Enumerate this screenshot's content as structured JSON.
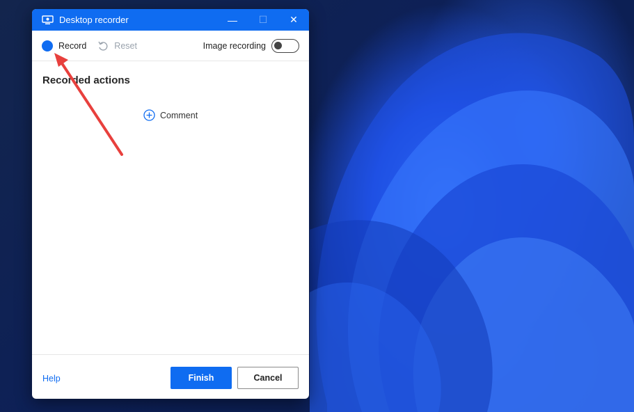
{
  "window": {
    "title": "Desktop recorder",
    "controls": {
      "minimize": "—",
      "maximize": "☐",
      "close": "✕"
    }
  },
  "toolbar": {
    "record_label": "Record",
    "reset_label": "Reset",
    "image_recording_label": "Image recording",
    "image_recording_on": false
  },
  "content": {
    "section_title": "Recorded actions",
    "comment_label": "Comment"
  },
  "footer": {
    "help_label": "Help",
    "finish_label": "Finish",
    "cancel_label": "Cancel"
  },
  "colors": {
    "accent": "#0f6cf1",
    "annotation_arrow": "#e8403d"
  },
  "icons": [
    "monitor-icon",
    "record-icon",
    "undo-icon",
    "add-circle-icon"
  ]
}
